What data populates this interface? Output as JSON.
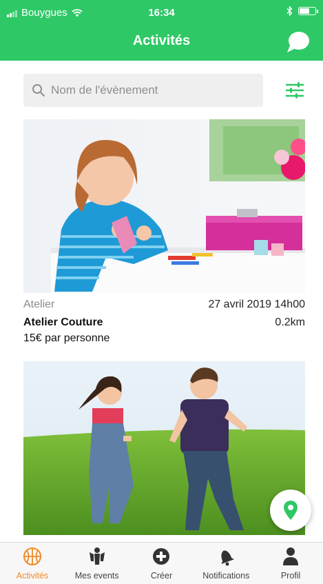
{
  "status_bar": {
    "carrier": "Bouygues",
    "time": "16:34"
  },
  "header": {
    "title": "Activités"
  },
  "search": {
    "placeholder": "Nom de l'évènement"
  },
  "activities": [
    {
      "category": "Atelier",
      "date": "27 avril 2019 14h00",
      "title": "Atelier Couture",
      "distance": "0.2km",
      "price": "15€ par personne"
    }
  ],
  "tabs": [
    {
      "label": "Activités",
      "icon": "basketball-icon",
      "active": true
    },
    {
      "label": "Mes events",
      "icon": "people-icon",
      "active": false
    },
    {
      "label": "Créer",
      "icon": "plus-circle-icon",
      "active": false
    },
    {
      "label": "Notifications",
      "icon": "bell-icon",
      "active": false
    },
    {
      "label": "Profil",
      "icon": "user-icon",
      "active": false
    }
  ],
  "colors": {
    "brand_green": "#2ec866",
    "active_tab": "#f08a24",
    "inactive_tab": "#444444"
  }
}
